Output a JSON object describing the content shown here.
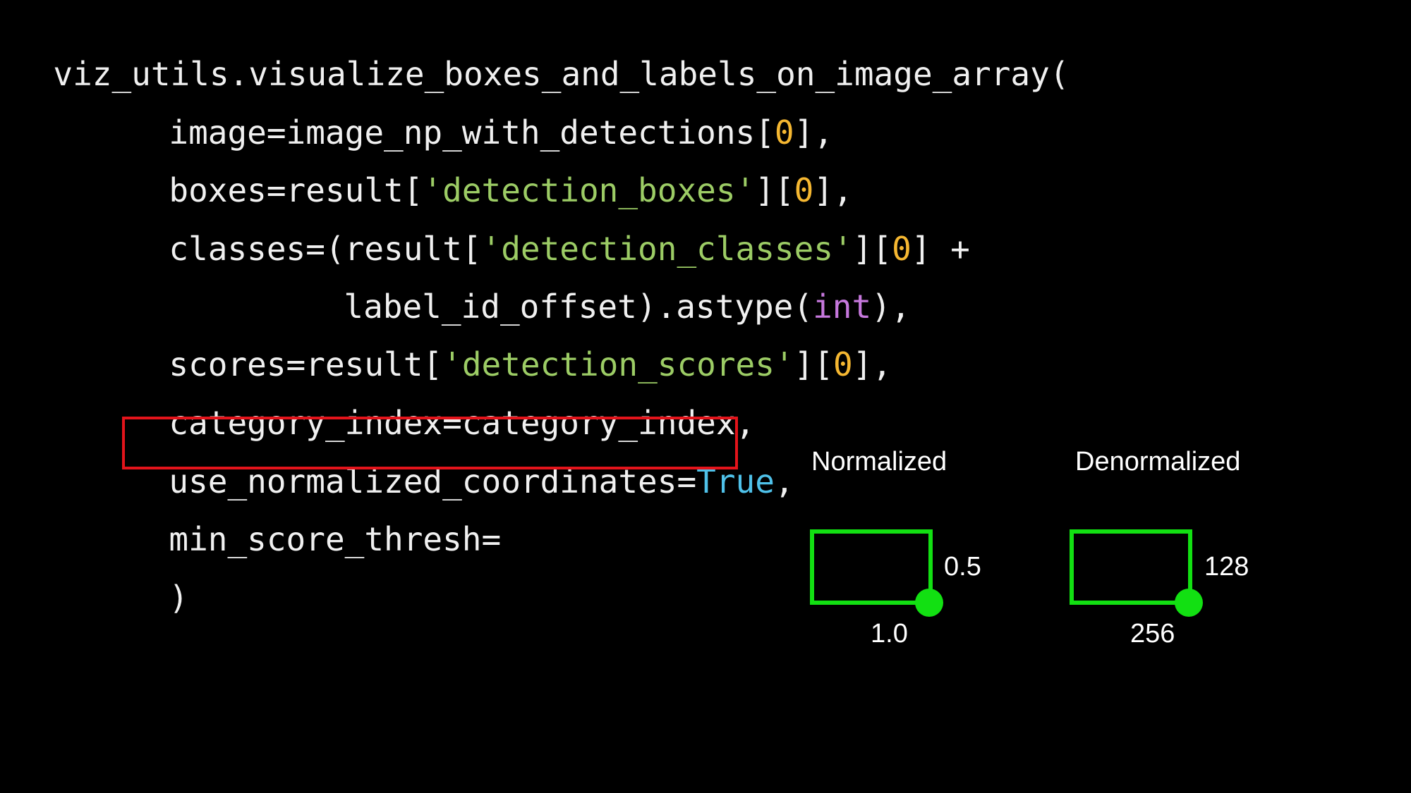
{
  "colors": {
    "background": "#000000",
    "text": "#f0f0f0",
    "string": "#9ccc65",
    "number": "#f5b731",
    "builtin": "#c678dd",
    "keyword_true": "#4fc1e9",
    "highlight_border": "#e3141b",
    "box_green": "#12e012"
  },
  "code": {
    "line1": {
      "t1": "viz_utils.visualize_boxes_and_labels_on_image_array("
    },
    "line2": {
      "t1": "image=image_np_with_detections[",
      "t2": "0",
      "t3": "],"
    },
    "line3": {
      "t1": "boxes=result[",
      "t2": "'detection_boxes'",
      "t3": "][",
      "t4": "0",
      "t5": "],"
    },
    "line4": {
      "t1": "classes=(result[",
      "t2": "'detection_classes'",
      "t3": "][",
      "t4": "0",
      "t5": "] +"
    },
    "line5": {
      "t1": "label_id_offset).astype(",
      "t2": "int",
      "t3": "),"
    },
    "line6": {
      "t1": "scores=result[",
      "t2": "'detection_scores'",
      "t3": "][",
      "t4": "0",
      "t5": "],"
    },
    "line7": {
      "t1": "category_index=category_index,"
    },
    "line8": {
      "t1": "use_normalized_coordinates=",
      "t2": "True",
      "t3": ","
    },
    "line9": {
      "t1": "min_score_thresh="
    },
    "line10": {
      "t1": ")"
    }
  },
  "diagram": {
    "normalized": {
      "title": "Normalized",
      "height_label": "0.5",
      "width_label": "1.0"
    },
    "denormalized": {
      "title": "Denormalized",
      "height_label": "128",
      "width_label": "256"
    }
  }
}
